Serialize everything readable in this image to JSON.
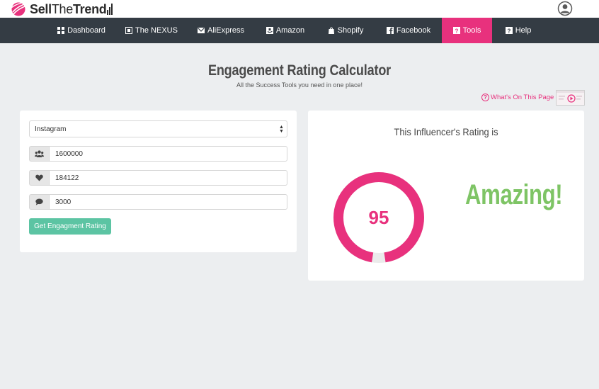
{
  "brand": {
    "name_bold_1": "Sell",
    "name_thin": "The",
    "name_bold_2": "Trend"
  },
  "nav": {
    "items": [
      {
        "label": "Dashboard",
        "icon": "dashboard-icon"
      },
      {
        "label": "The NEXUS",
        "icon": "nexus-icon"
      },
      {
        "label": "AliExpress",
        "icon": "aliexpress-icon"
      },
      {
        "label": "Amazon",
        "icon": "amazon-icon"
      },
      {
        "label": "Shopify",
        "icon": "shopify-icon"
      },
      {
        "label": "Facebook",
        "icon": "facebook-icon"
      },
      {
        "label": "Tools",
        "icon": "tools-icon",
        "active": true
      },
      {
        "label": "Help",
        "icon": "help-icon"
      }
    ]
  },
  "page": {
    "title": "Engagement Rating Calculator",
    "subtitle": "All the Success Tools you need in one place!",
    "whats_on_label": "What's On This Page"
  },
  "form": {
    "platform": "Instagram",
    "followers": "1600000",
    "likes": "184122",
    "comments": "3000",
    "button_label": "Get Engagment Rating"
  },
  "result": {
    "heading": "This Influencer's Rating is",
    "score": 95,
    "score_max": 100,
    "verdict": "Amazing!"
  },
  "colors": {
    "accent": "#e8317d",
    "nav_bg": "#343c44",
    "button": "#5cc4a3",
    "verdict": "#7ec465"
  }
}
